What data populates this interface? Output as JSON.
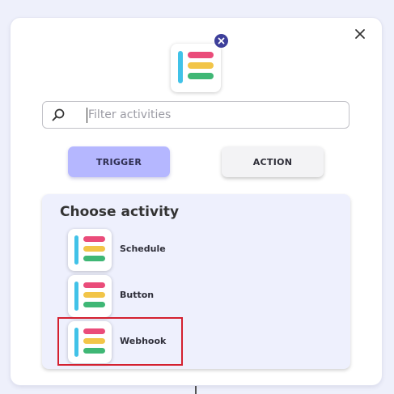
{
  "dialog": {
    "close_icon": "close-icon",
    "app_icon": "app-logo-icon",
    "remove_badge_icon": "remove-badge-icon"
  },
  "search": {
    "placeholder": "Filter activities",
    "value": "",
    "icon": "search-icon"
  },
  "tabs": [
    {
      "label": "TRIGGER",
      "selected": true
    },
    {
      "label": "ACTION",
      "selected": false
    }
  ],
  "panel": {
    "title": "Choose activity",
    "items": [
      {
        "label": "Schedule",
        "icon": "app-logo-icon"
      },
      {
        "label": "Button",
        "icon": "app-logo-icon"
      },
      {
        "label": "Webhook",
        "icon": "app-logo-icon",
        "highlighted": true
      }
    ]
  },
  "colors": {
    "trigger_bg": "#b5b7ff",
    "action_bg": "#f3f3f5",
    "panel_bg": "#eef0fd",
    "badge_bg": "#3d3f9a",
    "highlight_border": "#d4202f",
    "logo_blue": "#41c2e8",
    "logo_pink": "#ea4c7a",
    "logo_yellow": "#f2c548",
    "logo_green": "#3fb775"
  }
}
